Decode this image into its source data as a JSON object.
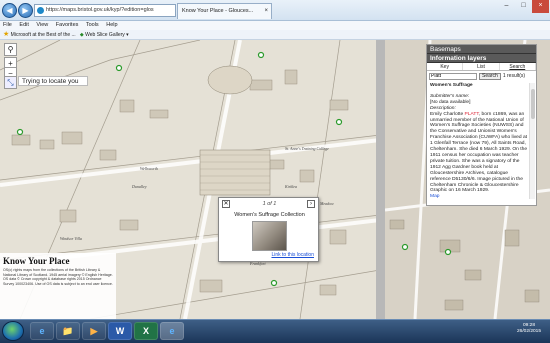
{
  "browser": {
    "url": "https://maps.bristol.gov.uk/kyp/?edition=glos",
    "tabs": [
      {
        "label": "Know Your Place - Glouces...",
        "close": "×"
      }
    ],
    "nav": {
      "back": "◀",
      "forward": "▶"
    },
    "window_controls": [
      "–",
      "□",
      "×"
    ],
    "menu": [
      "File",
      "Edit",
      "View",
      "Favorites",
      "Tools",
      "Help"
    ],
    "favorites": [
      {
        "label": "Microsoft at the Best of the ..."
      },
      {
        "label": "Web Slice Gallery ▾"
      }
    ]
  },
  "map": {
    "locate_message": "Trying to locate you",
    "controls": {
      "search": "⚲",
      "zoom_in": "+",
      "zoom_out": "−",
      "measure": "⤡"
    },
    "labels": [
      "Dunalley",
      "St. Anne's Training College",
      "Kirklea",
      "Windsor Villa",
      "Frankfort",
      "Wellsworth",
      "Meadow"
    ]
  },
  "kyp": {
    "title": "Know Your Place",
    "credit": "OS(c) rights maps from the collections of the British Library & National Library of Scotland. 1945 aerial imagery © English Heritage. OS data © Crown copyright & database rights 2015 Ordnance Survey 100023406. Use of OS data is subject to an end user licence."
  },
  "popup": {
    "count": "1 of 1",
    "prev": "✕",
    "next": "›",
    "title": "Women's Suffrage Collection",
    "link": "Link to this location"
  },
  "sidebar": {
    "basemaps_label": "Basemaps",
    "info_label": "Information layers",
    "tabs": [
      "Key",
      "List",
      "Search"
    ],
    "search": {
      "value": "Platt",
      "button": "Search",
      "result_count": "1 result(s)"
    },
    "record": {
      "title": "Women's Suffrage",
      "submitter_label": "Submitter's name:",
      "submitter_value": "[No data available]",
      "description_label": "Description:",
      "desc_before": "Emily Charlotte ",
      "desc_highlight": "PLATT",
      "desc_after": ", born c1869, was an unmarried member of the National Union of Women's Suffrage Societies (NUWSS) and the Conservative and Unionist Women's Franchise Association (CUWFA) who lived at 1 Glenfall Terrace (now 79), All Saints Road, Cheltenham. She died 6 March 1929. On the 1911 census her occupation was teacher private tuition. She was a signatory of the 1912 Agg Gardner book held at Gloucestershire Archives, catalogue reference D5130/6/6. Image pictured in the Cheltenham Chronicle & Gloucestershire Graphic on 16 March 1929.",
      "map_link": "Map"
    }
  },
  "taskbar": {
    "apps": [
      "e",
      "📁",
      "▶",
      "W",
      "X",
      "e"
    ],
    "clock_time": "09:28",
    "clock_date": "26/02/2015"
  },
  "colors": {
    "accent": "#1a4fd6",
    "highlight": "#d22233",
    "taskbar": "#1b3558"
  }
}
